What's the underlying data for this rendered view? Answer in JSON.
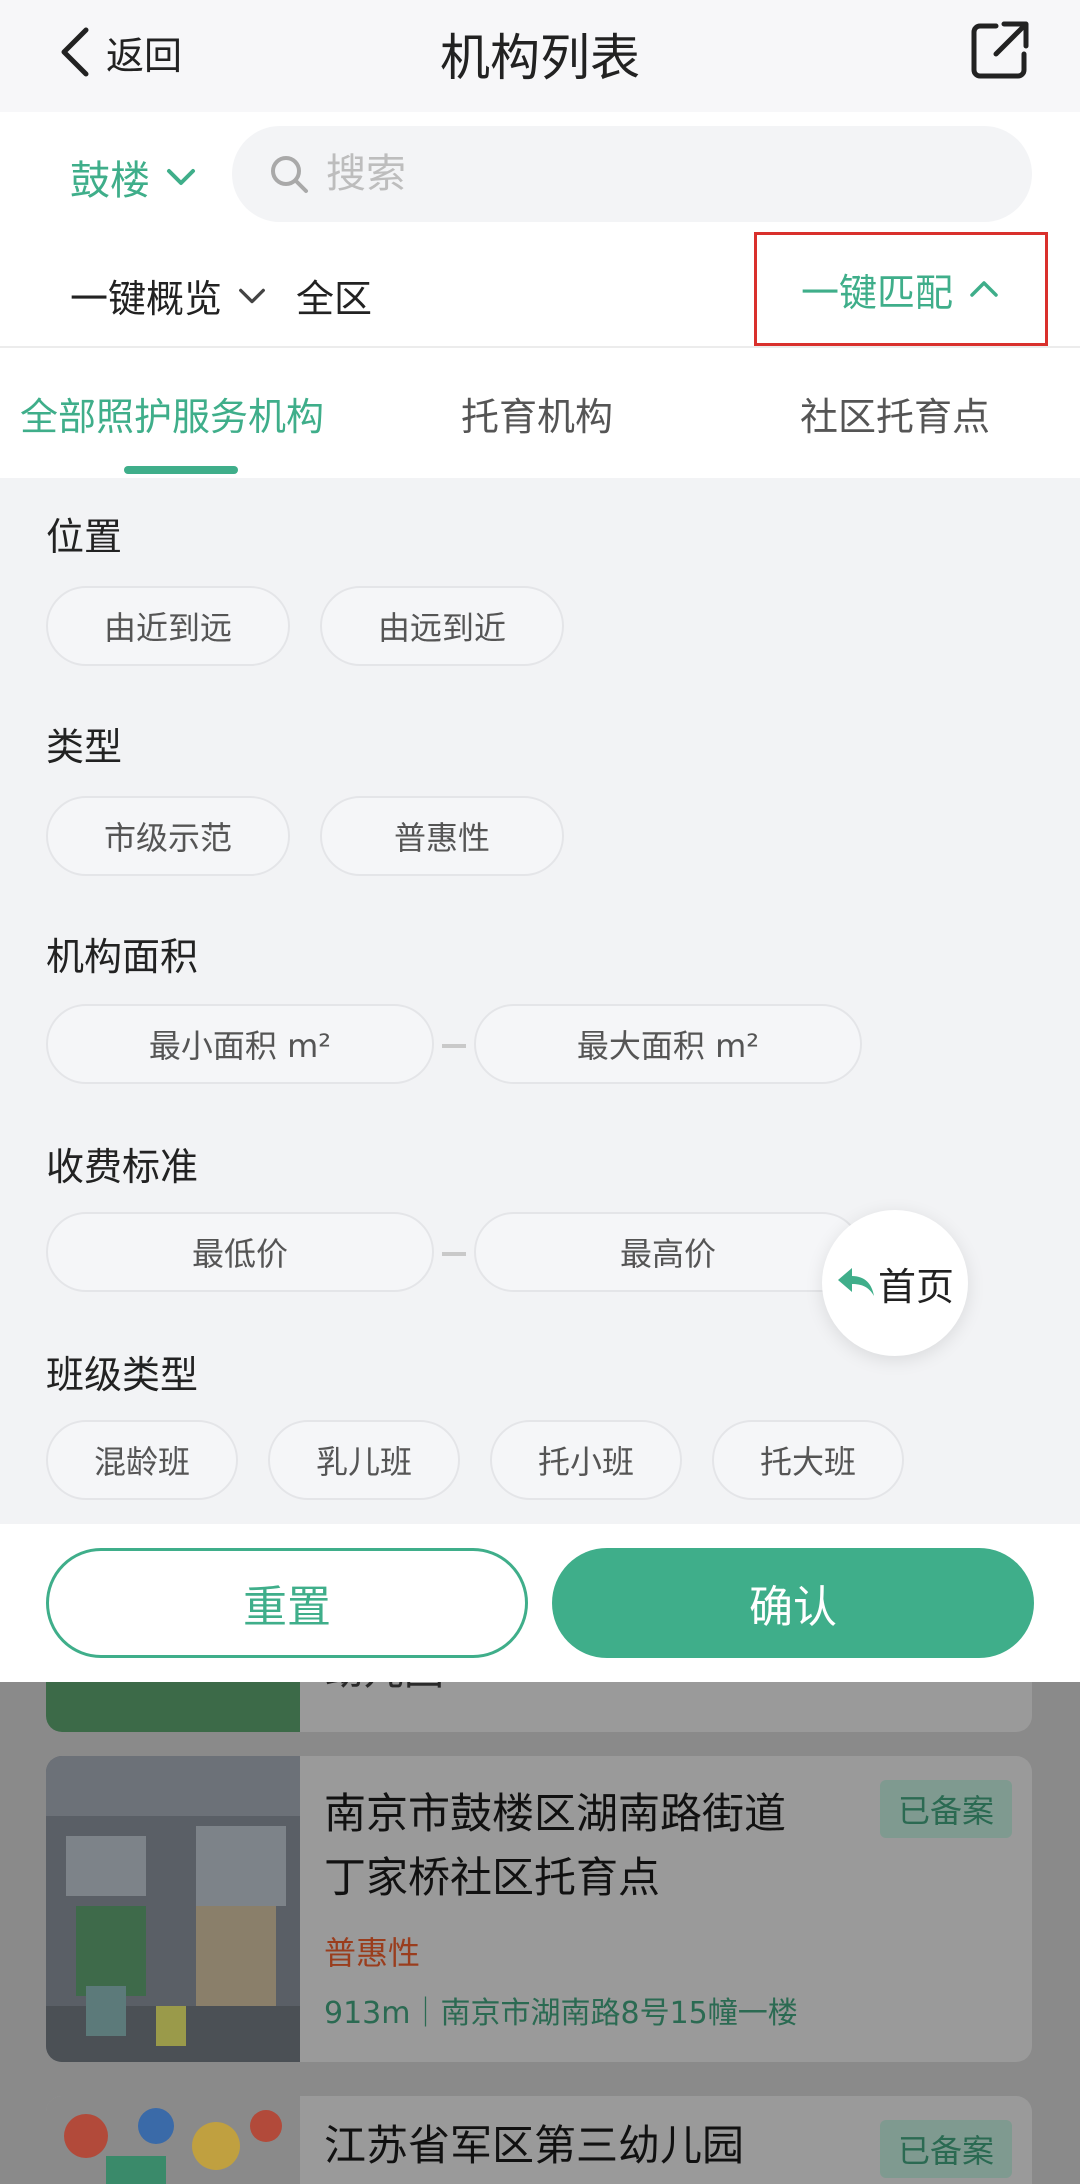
{
  "header": {
    "back_label": "返回",
    "title": "机构列表",
    "share_icon": "external-link-icon"
  },
  "search": {
    "district": "鼓楼",
    "placeholder": "搜索"
  },
  "filters": {
    "overview": "一键概览",
    "area": "全区",
    "match": "一键匹配"
  },
  "tabs": [
    {
      "label": "全部照护服务机构",
      "active": true
    },
    {
      "label": "托育机构",
      "active": false
    },
    {
      "label": "社区托育点",
      "active": false
    }
  ],
  "panel": {
    "location": {
      "title": "位置",
      "options": [
        "由近到远",
        "由远到近"
      ]
    },
    "type": {
      "title": "类型",
      "options": [
        "市级示范",
        "普惠性"
      ]
    },
    "size": {
      "title": "机构面积",
      "min_placeholder": "最小面积 m²",
      "max_placeholder": "最大面积 m²"
    },
    "fee": {
      "title": "收费标准",
      "min_placeholder": "最低价",
      "max_placeholder": "最高价"
    },
    "class_type": {
      "title": "班级类型",
      "options": [
        "混龄班",
        "乳儿班",
        "托小班",
        "托大班"
      ]
    }
  },
  "float_home": {
    "label": "首页"
  },
  "actions": {
    "reset": "重置",
    "confirm": "确认"
  },
  "list": [
    {
      "name_partial": "幼儿园"
    },
    {
      "name_line1": "南京市鼓楼区湖南路街道",
      "name_line2": "丁家桥社区托育点",
      "badge": "已备案",
      "tag": "普惠性",
      "address": "913m｜南京市湖南路8号15幢一楼"
    },
    {
      "name_line1": "江苏省军区第三幼儿园",
      "badge": "已备案"
    }
  ],
  "colors": {
    "accent": "#3fae8a",
    "highlight_border": "#d9302c"
  }
}
